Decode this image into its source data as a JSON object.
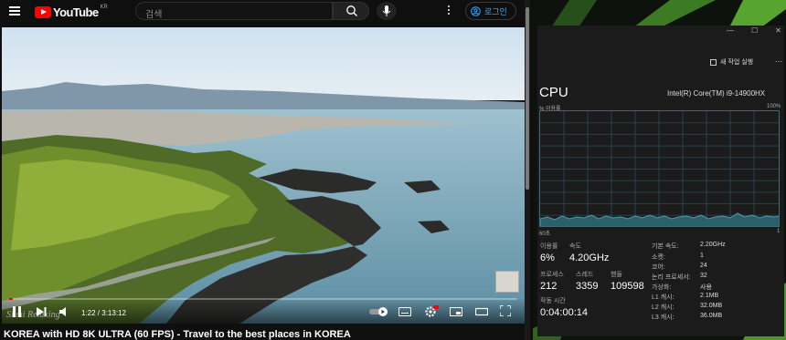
{
  "youtube": {
    "logo_text": "YouTube",
    "region": "KR",
    "search_placeholder": "검색",
    "login_label": "로그인",
    "time_current": "1:22",
    "time_separator": " / ",
    "time_total": "3:13:12",
    "progress": 0.007,
    "watermark": "Slimi Relaxing",
    "video_title": "KOREA with HD 8K ULTRA (60 FPS) - Travel to the best places in KOREA"
  },
  "taskmanager": {
    "window_buttons": [
      "—",
      "☐",
      "✕"
    ],
    "new_task_label": "새 작업 실행",
    "more_label": "⋯",
    "section_title": "CPU",
    "cpu_model": "Intel(R) Core(TM) i9-14900HX",
    "utilization_label": "% 이용률",
    "utilization_max": "100%",
    "axis_left": "60초",
    "axis_right": "1",
    "stats": {
      "usage_label": "이용률",
      "usage_value": "6%",
      "speed_label": "속도",
      "speed_value": "4.20GHz",
      "process_label": "프로세스",
      "process_value": "212",
      "thread_label": "스레드",
      "thread_value": "3359",
      "handle_label": "핸들",
      "handle_value": "109598",
      "uptime_label": "작동 시간",
      "uptime_value": "0:04:00:14"
    },
    "specs": [
      {
        "key": "기본 속도:",
        "value": "2.20GHz"
      },
      {
        "key": "소켓:",
        "value": "1"
      },
      {
        "key": "코어:",
        "value": "24"
      },
      {
        "key": "논리 프로세서:",
        "value": "32"
      },
      {
        "key": "가상화:",
        "value": "사용"
      },
      {
        "key": "L1 캐시:",
        "value": "2.1MB"
      },
      {
        "key": "L2 캐시:",
        "value": "32.0MB"
      },
      {
        "key": "L3 캐시:",
        "value": "36.0MB"
      }
    ]
  },
  "colors": {
    "youtube_red": "#ff0000",
    "link_blue": "#3ea6ff",
    "graph_line": "#4a9db3",
    "graph_fill": "#2c5f6c"
  }
}
